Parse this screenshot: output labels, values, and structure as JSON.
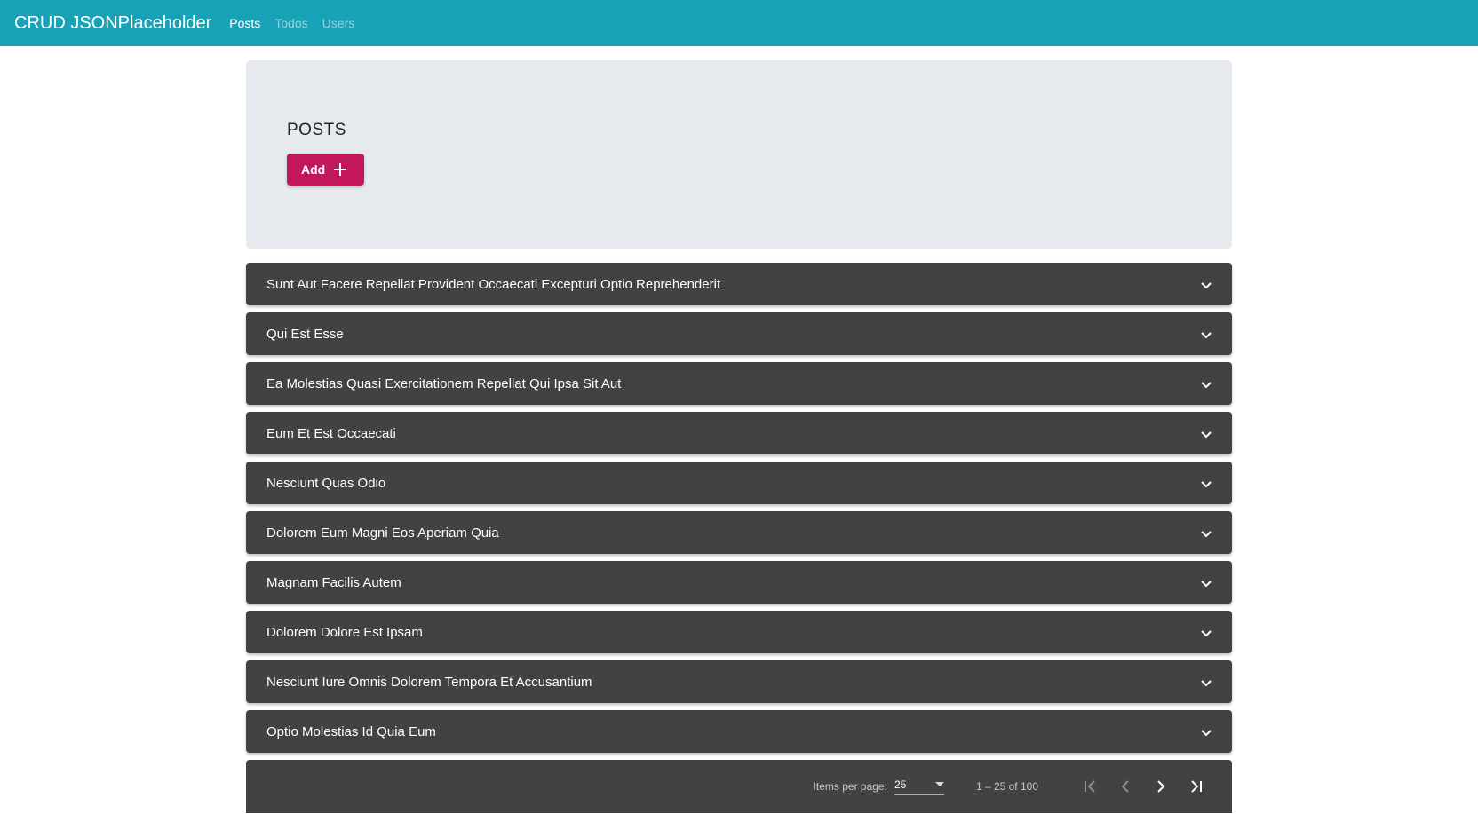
{
  "navbar": {
    "brand": "CRUD JSONPlaceholder",
    "links": [
      {
        "label": "Posts",
        "active": true
      },
      {
        "label": "Todos",
        "active": false
      },
      {
        "label": "Users",
        "active": false
      }
    ],
    "color": "#17a2b8"
  },
  "header": {
    "title": "POSTS",
    "add_label": "Add",
    "add_icon": "plus-icon",
    "add_color": "#c2185b"
  },
  "posts": [
    "Sunt Aut Facere Repellat Provident Occaecati Excepturi Optio Reprehenderit",
    "Qui Est Esse",
    "Ea Molestias Quasi Exercitationem Repellat Qui Ipsa Sit Aut",
    "Eum Et Est Occaecati",
    "Nesciunt Quas Odio",
    "Dolorem Eum Magni Eos Aperiam Quia",
    "Magnam Facilis Autem",
    "Dolorem Dolore Est Ipsam",
    "Nesciunt Iure Omnis Dolorem Tempora Et Accusantium",
    "Optio Molestias Id Quia Eum"
  ],
  "paginator": {
    "items_per_page_label": "Items per page:",
    "items_per_page_value": "25",
    "range_label": "1 – 25 of 100",
    "icons": [
      "first-page-icon",
      "previous-page-icon",
      "next-page-icon",
      "last-page-icon"
    ]
  }
}
